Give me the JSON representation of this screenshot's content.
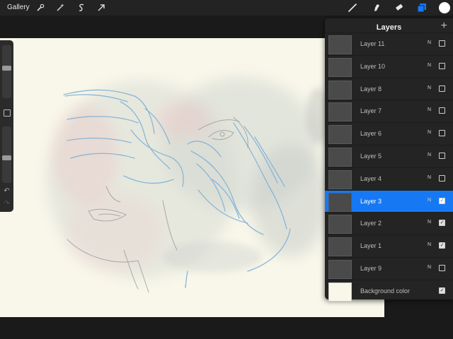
{
  "topbar": {
    "gallery_label": "Gallery",
    "tools": [
      {
        "name": "wrench-icon"
      },
      {
        "name": "magic-wand-icon"
      },
      {
        "name": "selection-s-icon"
      },
      {
        "name": "transform-arrow-icon"
      },
      {
        "name": "brush-icon"
      },
      {
        "name": "smudge-icon"
      },
      {
        "name": "eraser-icon"
      },
      {
        "name": "layers-icon"
      },
      {
        "name": "color-swatch"
      }
    ],
    "accent_color": "#1679f3",
    "active_color": "#ffffff"
  },
  "sidebar": {
    "brush_size_level": 0.58,
    "opacity_level": 0.44,
    "undo_glyph": "↶",
    "redo_glyph": "↷"
  },
  "layers_panel": {
    "title": "Layers",
    "add_glyph": "+",
    "layers": [
      {
        "name": "Layer 11",
        "blend": "N",
        "visible": false,
        "selected": false
      },
      {
        "name": "Layer 10",
        "blend": "N",
        "visible": false,
        "selected": false
      },
      {
        "name": "Layer 8",
        "blend": "N",
        "visible": false,
        "selected": false
      },
      {
        "name": "Layer 7",
        "blend": "N",
        "visible": false,
        "selected": false
      },
      {
        "name": "Layer 6",
        "blend": "N",
        "visible": false,
        "selected": false
      },
      {
        "name": "Layer 5",
        "blend": "N",
        "visible": false,
        "selected": false
      },
      {
        "name": "Layer 4",
        "blend": "N",
        "visible": false,
        "selected": false
      },
      {
        "name": "Layer 3",
        "blend": "N",
        "visible": true,
        "selected": true
      },
      {
        "name": "Layer 2",
        "blend": "N",
        "visible": true,
        "selected": false
      },
      {
        "name": "Layer 1",
        "blend": "N",
        "visible": true,
        "selected": false
      },
      {
        "name": "Layer 9",
        "blend": "N",
        "visible": false,
        "selected": false
      }
    ],
    "background": {
      "name": "Background color",
      "visible": true,
      "color": "#f9f7ea"
    }
  }
}
